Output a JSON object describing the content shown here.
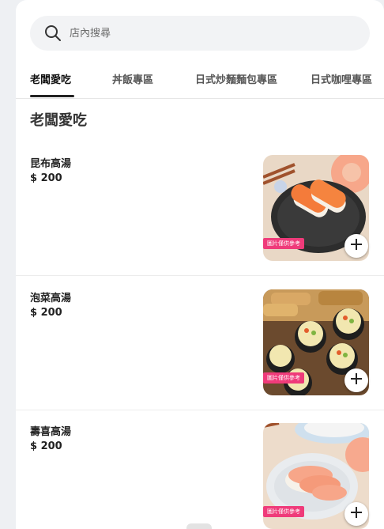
{
  "search": {
    "placeholder": "店內搜尋"
  },
  "tabs": [
    {
      "label": "老闆愛吃",
      "active": true
    },
    {
      "label": "丼飯專區",
      "active": false
    },
    {
      "label": "日式炒麵麵包專區",
      "active": false
    },
    {
      "label": "日式咖哩專區",
      "active": false
    }
  ],
  "section": {
    "title": "老闆愛吃"
  },
  "items": [
    {
      "name": "昆布高湯",
      "price": "$ 200",
      "image_tag": "圖片僅供參考"
    },
    {
      "name": "泡菜高湯",
      "price": "$ 200",
      "image_tag": "圖片僅供參考"
    },
    {
      "name": "壽喜高湯",
      "price": "$ 200",
      "image_tag": "圖片僅供參考"
    }
  ],
  "icons": {
    "search": "search-icon",
    "add": "plus-icon"
  },
  "colors": {
    "accent": "#222222",
    "tag": "#ef3b7a",
    "search_bg": "#f2f3f5"
  }
}
